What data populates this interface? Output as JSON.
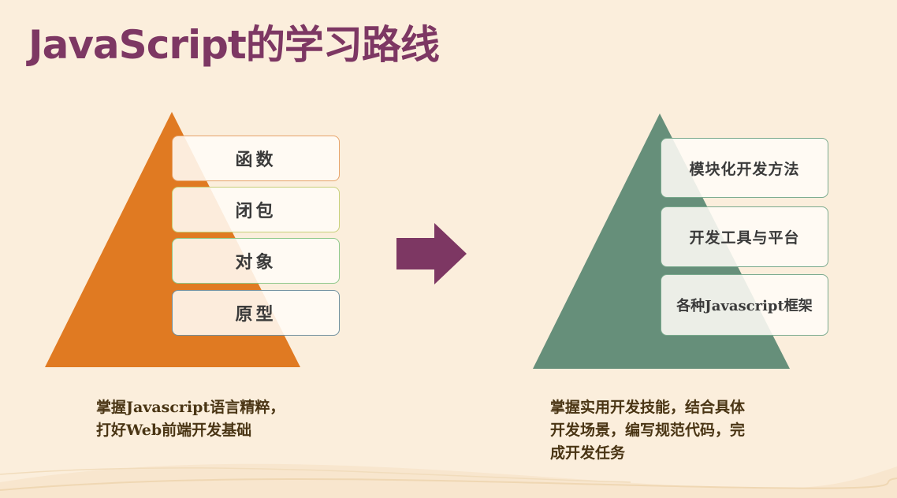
{
  "title": "JavaScript的学习路线",
  "colors": {
    "background": "#fbeedc",
    "title": "#7d3763",
    "left_pyramid": "#e07a22",
    "right_pyramid": "#668f7a",
    "arrow": "#7d3763",
    "left_box_borders": [
      "#e6a36a",
      "#c7d07a",
      "#8ec88a",
      "#6f8f9e"
    ],
    "right_box_border": "#7aaa8e",
    "caption": "#4a3514"
  },
  "left": {
    "steps": [
      "函数",
      "闭包",
      "对象",
      "原型"
    ],
    "caption_lines": [
      "掌握Javascript语言精粹，",
      "打好Web前端开发基础"
    ]
  },
  "arrow_icon": "right-arrow-icon",
  "right": {
    "steps": [
      "模块化开发方法",
      "开发工具与平台",
      "各种Javascript框架"
    ],
    "caption_lines": [
      "掌握实用开发技能，结合具体",
      "开发场景，编写规范代码，完",
      "成开发任务"
    ]
  }
}
